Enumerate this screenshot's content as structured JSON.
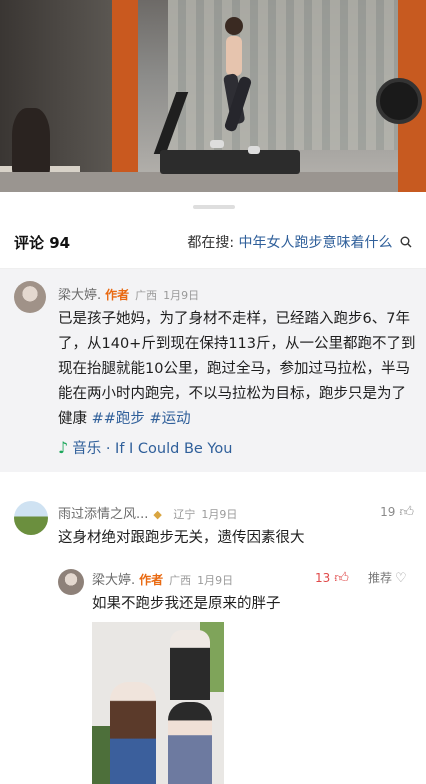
{
  "header": {
    "comments_label": "评论 94",
    "search_prefix": "都在搜:",
    "search_query": "中年女人跑步意味着什么"
  },
  "comments": [
    {
      "name": "梁大婷.",
      "author_tag": "作者",
      "location": "广西",
      "date": "1月9日",
      "text": "已是孩子她妈，为了身材不走样，已经踏入跑步6、7年了，从140+斤到现在保持113斤，从一公里都跑不了到现在抬腿就能10公里，跑过全马，参加过马拉松，半马能在两小时内跑完，不以马拉松为目标，跑步只是为了健康 ",
      "tags": [
        "##跑步",
        "#运动"
      ],
      "music_label": "音乐",
      "music_title": "If I Could Be You"
    },
    {
      "name": "雨过添情之风...",
      "location": "辽宁",
      "date": "1月9日",
      "text": "这身材绝对跟跑步无关，遗传因素很大",
      "likes": "19"
    },
    {
      "name": "梁大婷.",
      "author_tag": "作者",
      "location": "广西",
      "date": "1月9日",
      "text": "如果不跑步我还是原来的胖子",
      "likes": "13",
      "recommend_label": "推荐"
    }
  ],
  "icons": {
    "music": "music-note-icon",
    "like": "thumbs-up-icon",
    "heart": "heart-icon",
    "search": "search-icon",
    "vip": "vip-badge-icon"
  },
  "colors": {
    "author_tag": "#e96a12",
    "link": "#2f5f9a",
    "liked": "#e04a4a",
    "music": "#1aa65a"
  }
}
